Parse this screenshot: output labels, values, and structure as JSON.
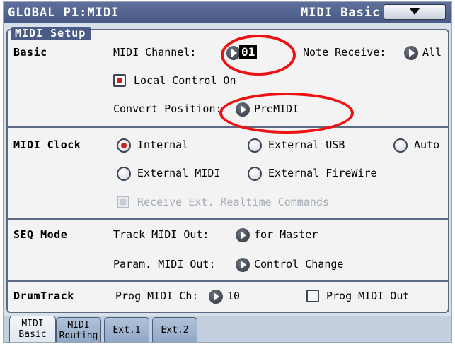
{
  "header": {
    "title": "GLOBAL P1:MIDI",
    "page_name": "MIDI Basic",
    "menu_icon": "chevron-down-icon"
  },
  "section": {
    "title": "MIDI Setup"
  },
  "basic": {
    "label": "Basic",
    "midi_channel_label": "MIDI Channel:",
    "midi_channel_value": "01",
    "note_receive_label": "Note Receive:",
    "note_receive_value": "All",
    "local_control_label": "Local Control On",
    "local_control_checked": true,
    "convert_position_label": "Convert Position:",
    "convert_position_value": "PreMIDI"
  },
  "midi_clock": {
    "label": "MIDI Clock",
    "options": [
      {
        "label": "Internal",
        "selected": true
      },
      {
        "label": "External USB",
        "selected": false
      },
      {
        "label": "Auto",
        "selected": false
      },
      {
        "label": "External MIDI",
        "selected": false
      },
      {
        "label": "External FireWire",
        "selected": false
      }
    ],
    "receive_realtime_label": "Receive Ext. Realtime Commands"
  },
  "seq_mode": {
    "label": "SEQ Mode",
    "track_midi_out_label": "Track MIDI Out:",
    "track_midi_out_value": "for Master",
    "param_midi_out_label": "Param. MIDI Out:",
    "param_midi_out_value": "Control Change"
  },
  "drumtrack": {
    "label": "DrumTrack",
    "prog_midi_ch_label": "Prog MIDI Ch:",
    "prog_midi_ch_value": "10",
    "prog_midi_out_label": "Prog MIDI Out"
  },
  "tabs": [
    {
      "label": "MIDI\nBasic",
      "active": true
    },
    {
      "label": "MIDI\nRouting",
      "active": false
    },
    {
      "label": "Ext.1",
      "active": false
    },
    {
      "label": "Ext.2",
      "active": false
    }
  ],
  "colors": {
    "title_bar": "#485a86",
    "annotation": "#ee1111",
    "check_red": "#c5271f"
  }
}
